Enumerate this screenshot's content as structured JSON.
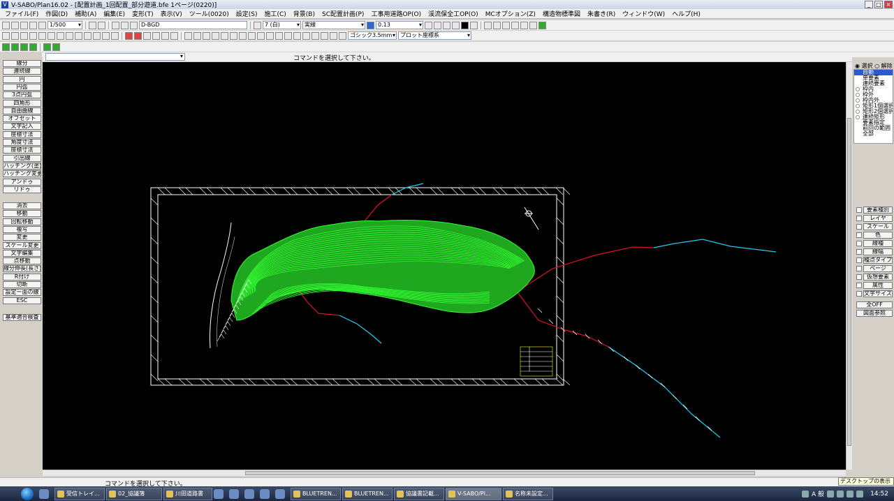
{
  "window": {
    "title": "V-SABO/Plan16.02 - [配置計画_1回配置_部分遊道.bfe 1ページ(0220)]"
  },
  "menu": [
    "ファイル(F)",
    "作図(D)",
    "補助(A)",
    "編集(E)",
    "変形(T)",
    "表示(V)",
    "ツール(0020)",
    "設定(S)",
    "施工(C)",
    "背景(B)",
    "SC配置計画(P)",
    "工事用道路OP(O)",
    "渓流保全工OP(O)",
    "MCオプション(Z)",
    "構造物標準図",
    "朱書き(R)",
    "ウィンドウ(W)",
    "ヘルプ(H)"
  ],
  "toolbar": {
    "scale": "1/500",
    "layer": "D-BGD",
    "color": "7 (白)",
    "linetype": "実線",
    "lineweight": "0.13",
    "font": "ゴシック3.5mm",
    "coords": "プロット座標系"
  },
  "command": {
    "prompt": "コマンドを選択して下さい。"
  },
  "left_buttons_top": [
    "線分",
    "連続線",
    "円",
    "円弧",
    "3点円弧",
    "四角形",
    "自由曲線",
    "オフセット",
    "文字記入",
    "座標寸法",
    "角度寸法",
    "座標寸法",
    "引出線",
    "ハッチング(塗)",
    "ハッチング変更",
    "アンドゥ",
    "リドゥ"
  ],
  "left_buttons_bottom": [
    "消去",
    "移動",
    "回転移動",
    "複写",
    "変更",
    "スケール変更",
    "文字編集",
    "点移動",
    "線分伸長(長さ)",
    "R付け",
    "切断",
    "設定ー面の線",
    "ESC"
  ],
  "left_button_extra": "基準適合検査",
  "right_panel": {
    "select_label": "選択",
    "release_label": "解除",
    "list": [
      "自動",
      "単要素",
      "連続要素",
      "枠内",
      "枠外",
      "枠内外",
      "矩形1個選択",
      "矩形2個選択",
      "連続矩形",
      "要素指定",
      "前回の範囲",
      "全部"
    ],
    "active_index": 0,
    "props": [
      "要素種別",
      "レイヤ",
      "スケール",
      "色",
      "線種",
      "線幅",
      "種点タイプ",
      "ページ",
      "仮想要素",
      "属性",
      "文字サイズ"
    ],
    "all_off": "全OFF",
    "restore": "図面参照"
  },
  "status": {
    "text": "コマンドを選択して下さい。"
  },
  "desktop_tip": "デスクトップの表示",
  "taskbar": {
    "tasks": [
      "受信トレイ...",
      "02_協議簿",
      "川田道路書",
      "BLUETREN...",
      "BLUETREN...",
      "協議書記載...",
      "V-SABO/Pl...",
      "名称未設定..."
    ],
    "active_index": 6,
    "ime": "A 般",
    "time": "14:52"
  },
  "colors": {
    "canvas": "#000000",
    "contour": "#33ff33",
    "road_red": "#e01020",
    "road_cyan": "#22ccee",
    "frame": "#ffffff"
  }
}
